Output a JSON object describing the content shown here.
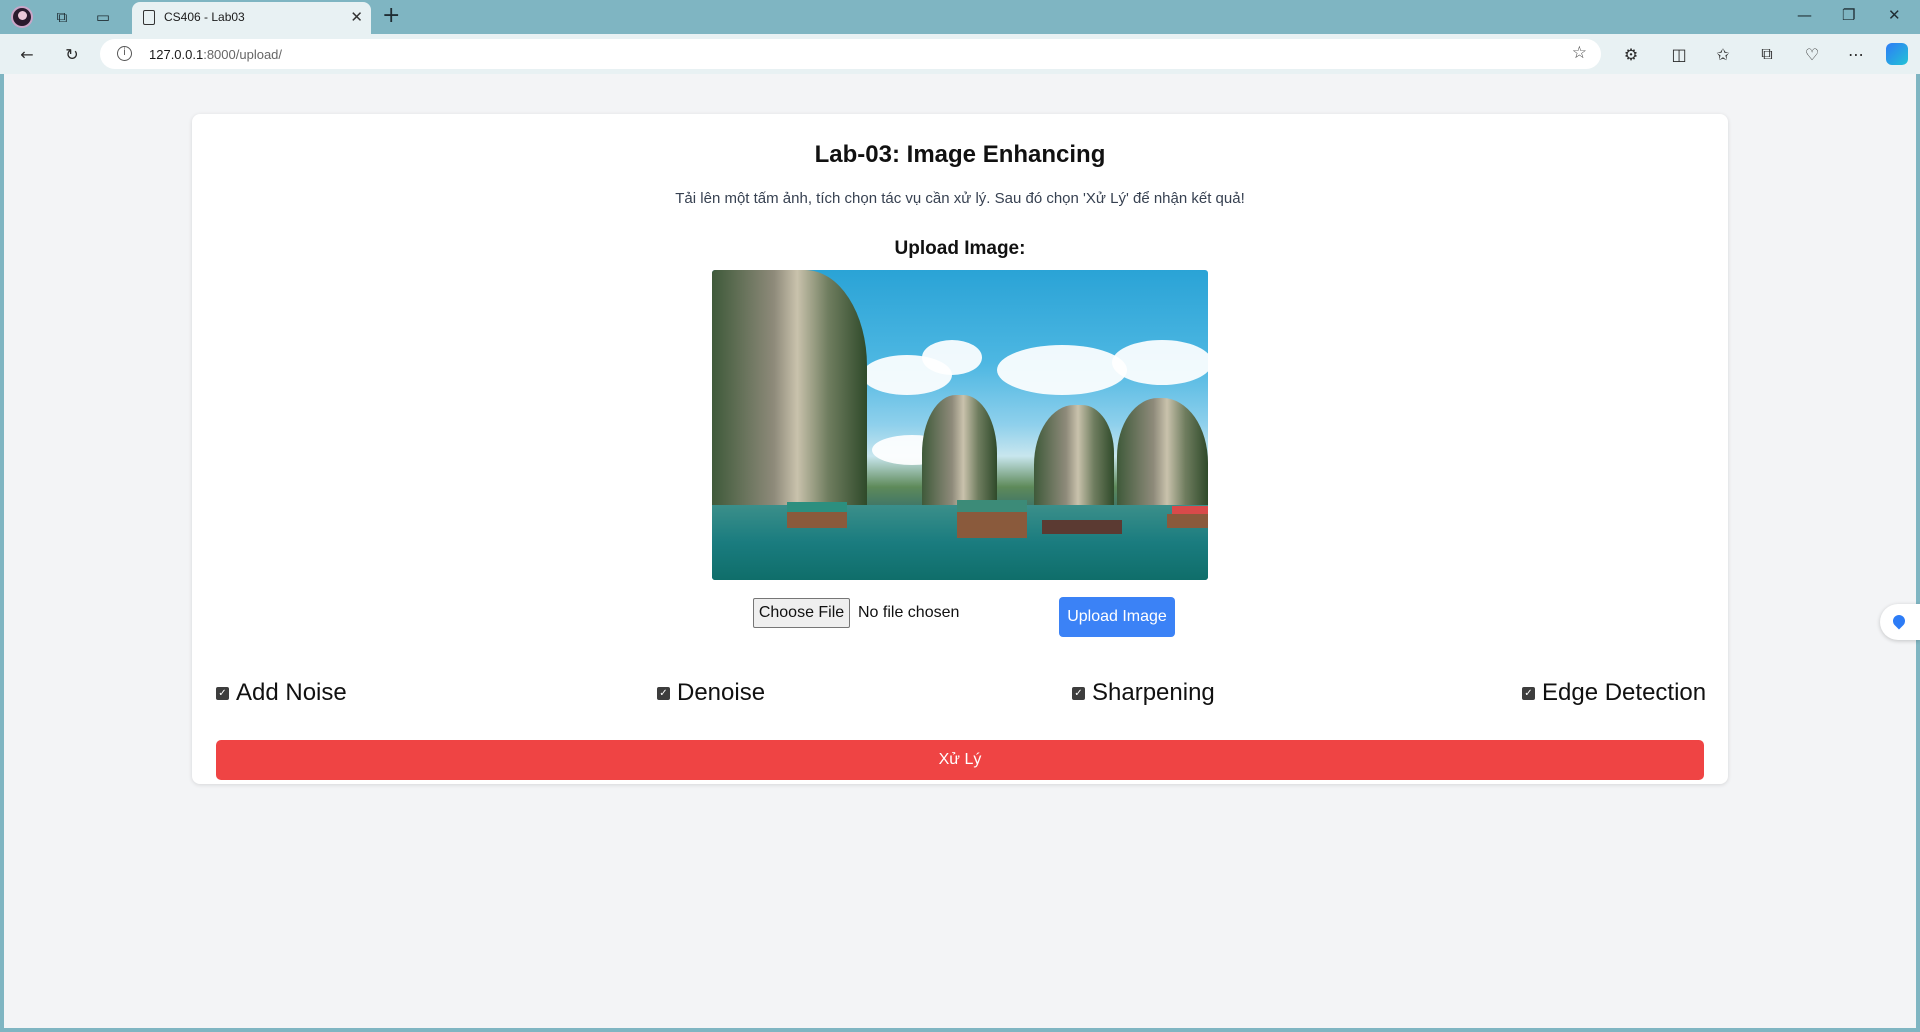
{
  "browser": {
    "tab_title": "CS406 - Lab03",
    "tab_close": "✕",
    "new_tab": "+",
    "url_host": "127.0.0.1",
    "url_rest": ":8000/upload/",
    "window": {
      "minimize": "—",
      "restore": "❐",
      "close": "✕"
    }
  },
  "page": {
    "heading": "Lab-03: Image Enhancing",
    "subtitle": "Tải lên một tấm ảnh, tích chọn tác vụ cần xử lý. Sau đó chọn 'Xử Lý' để nhận kết quả!",
    "upload_label": "Upload Image:",
    "file_button": "Choose File",
    "file_status": "No file chosen",
    "upload_button": "Upload Image",
    "options": [
      {
        "label": "Add Noise",
        "checked": true
      },
      {
        "label": "Denoise",
        "checked": true
      },
      {
        "label": "Sharpening",
        "checked": true
      },
      {
        "label": "Edge Detection",
        "checked": true
      }
    ],
    "process_button": "Xử Lý"
  },
  "colors": {
    "accent_blue": "#3b82f6",
    "process_red": "#ef4444",
    "browser_frame": "#7fb5c2"
  }
}
